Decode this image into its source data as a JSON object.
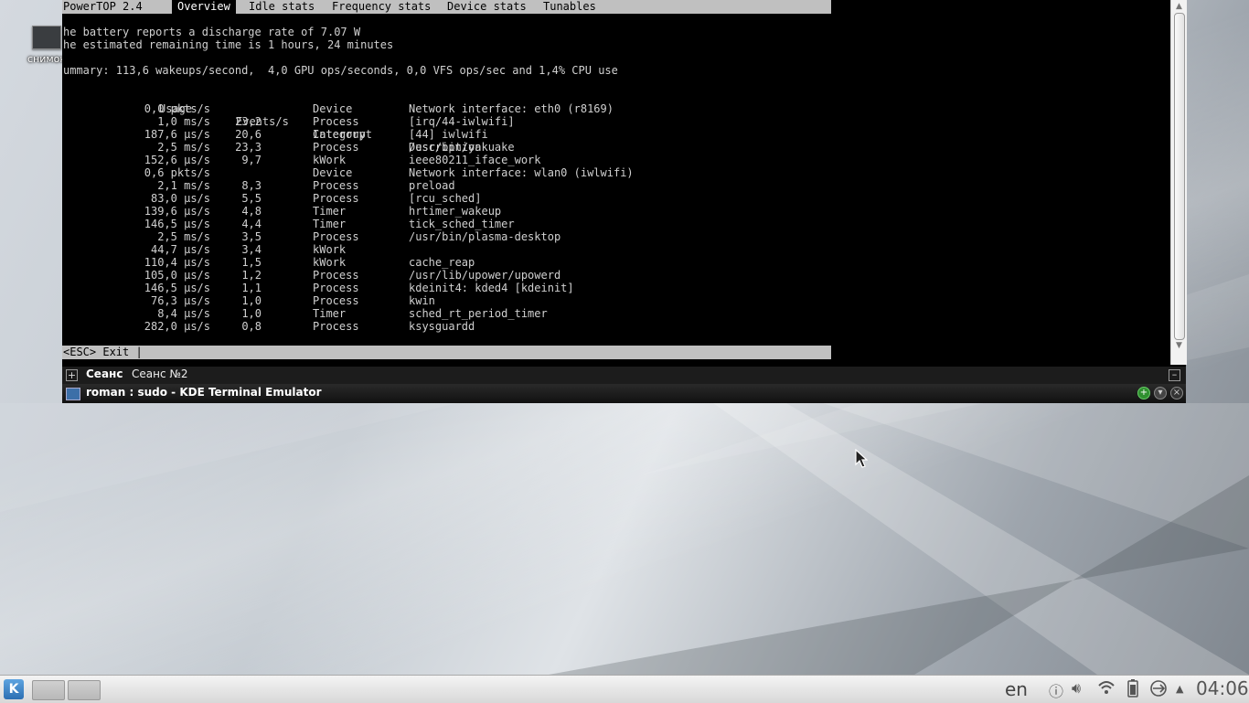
{
  "desktop": {
    "icon_label": "снимок"
  },
  "powertop": {
    "title": "PowerTOP 2.4",
    "tabs": [
      "Overview",
      "Idle stats",
      "Frequency stats",
      "Device stats",
      "Tunables"
    ],
    "active_tab": "Overview",
    "battery_line": "he battery reports a discharge rate of 7.07 W",
    "remaining_line": "he estimated remaining time is 1 hours, 24 minutes",
    "summary_line": "ummary: 113,6 wakeups/second,  4,0 GPU ops/seconds, 0,0 VFS ops/sec and 1,4% CPU use",
    "headers": {
      "usage": "Usage",
      "events": "Events/s",
      "category": "Category",
      "description": "Description"
    },
    "rows": [
      {
        "usage": "0,0 pkts/s",
        "events": "",
        "category": "Device",
        "description": "Network interface: eth0 (r8169)"
      },
      {
        "usage": "1,0 ms/s",
        "events": "23,2",
        "category": "Process",
        "description": "[irq/44-iwlwifi]"
      },
      {
        "usage": "187,6 µs/s",
        "events": "20,6",
        "category": "Interrupt",
        "description": "[44] iwlwifi"
      },
      {
        "usage": "2,5 ms/s",
        "events": "23,3",
        "category": "Process",
        "description": "/usr/bin/yakuake"
      },
      {
        "usage": "152,6 µs/s",
        "events": "9,7",
        "category": "kWork",
        "description": "ieee80211_iface_work"
      },
      {
        "usage": "0,6 pkts/s",
        "events": "",
        "category": "Device",
        "description": "Network interface: wlan0 (iwlwifi)"
      },
      {
        "usage": "2,1 ms/s",
        "events": "8,3",
        "category": "Process",
        "description": "preload"
      },
      {
        "usage": "83,0 µs/s",
        "events": "5,5",
        "category": "Process",
        "description": "[rcu_sched]"
      },
      {
        "usage": "139,6 µs/s",
        "events": "4,8",
        "category": "Timer",
        "description": "hrtimer_wakeup"
      },
      {
        "usage": "146,5 µs/s",
        "events": "4,4",
        "category": "Timer",
        "description": "tick_sched_timer"
      },
      {
        "usage": "2,5 ms/s",
        "events": "3,5",
        "category": "Process",
        "description": "/usr/bin/plasma-desktop"
      },
      {
        "usage": "44,7 µs/s",
        "events": "3,4",
        "category": "kWork",
        "description": ""
      },
      {
        "usage": "110,4 µs/s",
        "events": "1,5",
        "category": "kWork",
        "description": "cache_reap"
      },
      {
        "usage": "105,0 µs/s",
        "events": "1,2",
        "category": "Process",
        "description": "/usr/lib/upower/upowerd"
      },
      {
        "usage": "146,5 µs/s",
        "events": "1,1",
        "category": "Process",
        "description": "kdeinit4: kded4 [kdeinit]"
      },
      {
        "usage": "76,3 µs/s",
        "events": "1,0",
        "category": "Process",
        "description": "kwin"
      },
      {
        "usage": "8,4 µs/s",
        "events": "1,0",
        "category": "Timer",
        "description": "sched_rt_period_timer"
      },
      {
        "usage": "282,0 µs/s",
        "events": "0,8",
        "category": "Process",
        "description": "ksysguardd"
      }
    ],
    "bottom_hint": "<ESC> Exit |"
  },
  "yakuake": {
    "tabs": [
      "Сеанс",
      "Сеанс №2"
    ],
    "window_title": "roman : sudo - KDE Terminal Emulator"
  },
  "panel": {
    "language": "en",
    "clock": "04:06",
    "tray_icons": [
      "info-icon",
      "volume-icon",
      "wifi-icon",
      "battery-icon",
      "network-icon",
      "tray-expand-icon"
    ]
  }
}
